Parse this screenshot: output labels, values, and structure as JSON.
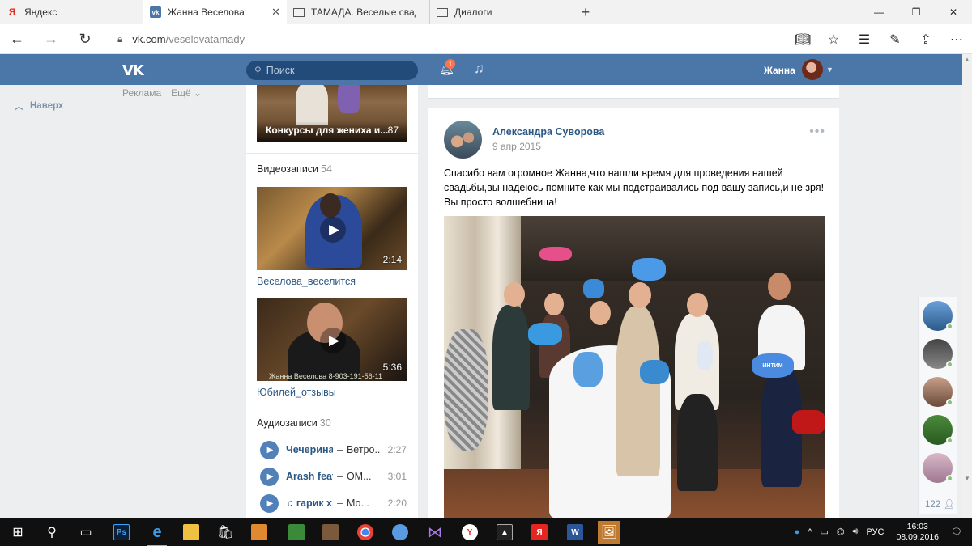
{
  "browser": {
    "tabs": [
      {
        "title": "Яндекс",
        "favicon": "Я",
        "favicon_color": "#e52620",
        "active": false
      },
      {
        "title": "Жанна Веселова",
        "favicon": "vk",
        "favicon_color": "#4a76a8",
        "active": true
      },
      {
        "title": "ТАМАДА. Веселые свадьб",
        "favicon": "page",
        "active": false
      },
      {
        "title": "Диалоги",
        "favicon": "page",
        "active": false
      }
    ],
    "new_tab": "+",
    "url_host": "vk.com",
    "url_path": "/veselovatamady"
  },
  "vk_header": {
    "logo": "VK",
    "search_placeholder": "Поиск",
    "notifications_count": "1",
    "user_name": "Жанна",
    "brand_color": "#4a76a8"
  },
  "left_menu": {
    "ads": "Реклама",
    "more": "Ещё",
    "back_to_top": "Наверх"
  },
  "sidebar": {
    "album": {
      "title": "Конкурсы для жениха и...",
      "count": "87"
    },
    "videos": {
      "heading": "Видеозаписи",
      "count": "54",
      "items": [
        {
          "duration": "2:14",
          "title": "Веселова_веселится"
        },
        {
          "duration": "5:36",
          "title": "Юбилей_отзывы",
          "caption": "Жанна Веселова 8-903-191-56-11"
        }
      ]
    },
    "audio": {
      "heading": "Аудиозаписи",
      "count": "30",
      "items": [
        {
          "artist": "Чечерина",
          "song": "Ветро...",
          "time": "2:27"
        },
        {
          "artist": "Arash feat....",
          "song": "OM...",
          "time": "3:01"
        },
        {
          "artist": "♫ гарик х...",
          "song": "Мо...",
          "time": "2:20"
        }
      ]
    }
  },
  "post": {
    "author": "Александра Суворова",
    "date": "9 апр 2015",
    "text": "Спасибо вам огромное Жанна,что нашли время для проведения нашей свадьбы,вы надеюсь помните как мы подстраивались под вашу запись,и не зря! Вы просто волшебница!",
    "photo_sign": "ИНТИМ"
  },
  "friends_rail": {
    "count": "122"
  },
  "taskbar": {
    "language": "РУС",
    "time": "16:03",
    "date": "08.09.2016"
  }
}
